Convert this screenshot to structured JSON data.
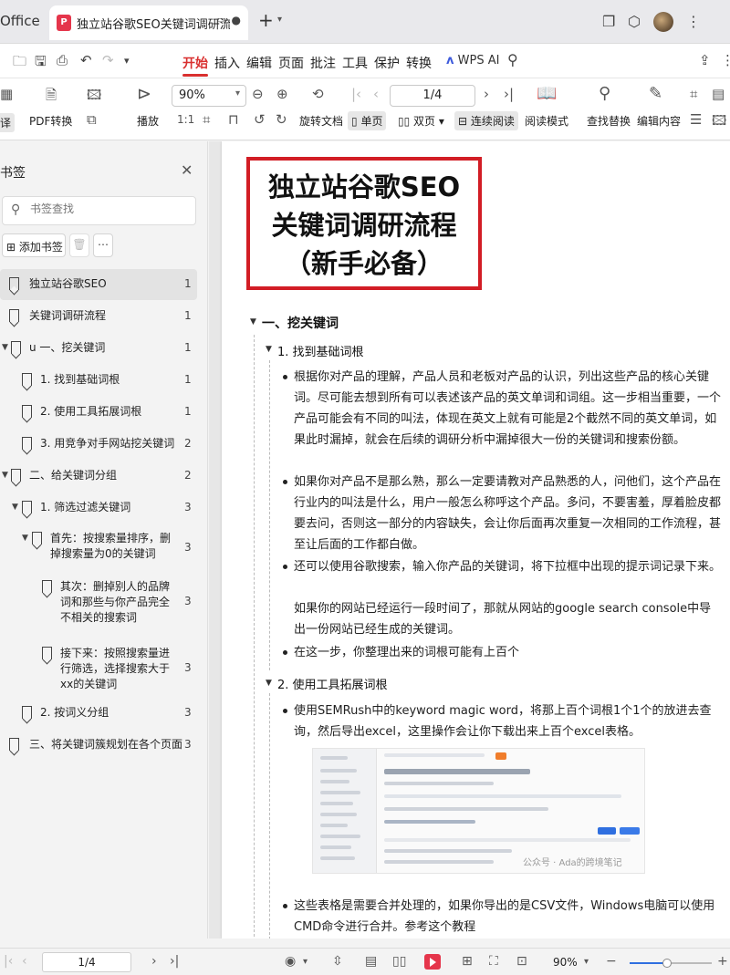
{
  "app": {
    "brand": "Office"
  },
  "tab": {
    "title": "独立站谷歌SEO关键词调研流程",
    "badge": "P"
  },
  "menu": {
    "items": [
      "开始",
      "插入",
      "编辑",
      "页面",
      "批注",
      "工具",
      "保护",
      "转换"
    ],
    "active_index": 0,
    "ai_label": "WPS AI"
  },
  "toolbar": {
    "pdf_convert": "PDF转换",
    "play": "播放",
    "zoom": "90%",
    "page": "1/4",
    "rotate": "旋转文档",
    "single": "单页",
    "double": "双页",
    "continuous": "连续阅读",
    "read_mode": "阅读模式",
    "find_replace": "查找替换",
    "edit_content": "编辑内容"
  },
  "sidebar": {
    "title": "书签",
    "search_placeholder": "书签查找",
    "add_button": "添加书签",
    "bookmarks": [
      {
        "label": "独立站谷歌SEO",
        "page": "1"
      },
      {
        "label": "关键词调研流程",
        "page": "1"
      },
      {
        "label": "u 一、挖关键词",
        "page": "1"
      },
      {
        "label": "1. 找到基础词根",
        "page": "1"
      },
      {
        "label": "2. 使用工具拓展词根",
        "page": "1"
      },
      {
        "label": "3. 用竞争对手网站挖关键词",
        "page": "2"
      },
      {
        "label": "二、给关键词分组",
        "page": "2"
      },
      {
        "label": "1. 筛选过滤关键词",
        "page": "3"
      },
      {
        "label": "首先：按搜索量排序，删掉搜索量为0的关键词",
        "page": "3"
      },
      {
        "label": "其次：删掉别人的品牌词和那些与你产品完全不相关的搜索词",
        "page": "3"
      },
      {
        "label": "接下来：按照搜索量进行筛选，选择搜索大于xx的关键词",
        "page": "3"
      },
      {
        "label": "2. 按词义分组",
        "page": "3"
      },
      {
        "label": "三、将关键词簇规划在各个页面",
        "page": "3"
      }
    ]
  },
  "document": {
    "title_lines": [
      "独立站谷歌SEO",
      "关键词调研流程",
      "（新手必备）"
    ],
    "h1": "一、挖关键词",
    "sec1": "1. 找到基础词根",
    "p1": "根据你对产品的理解，产品人员和老板对产品的认识，列出这些产品的核心关键词。尽可能去想到所有可以表述该产品的英文单词和词组。这一步相当重要，一个产品可能会有不同的叫法，体现在英文上就有可能是2个截然不同的英文单词，如果此时漏掉，就会在后续的调研分析中漏掉很大一份的关键词和搜索份额。",
    "p2": "如果你对产品不是那么熟，那么一定要请教对产品熟悉的人，问他们，这个产品在行业内的叫法是什么，用户一般怎么称呼这个产品。多问，不要害羞，厚着脸皮都要去问，否则这一部分的内容缺失，会让你后面再次重复一次相同的工作流程，甚至让后面的工作都白做。",
    "p3a": "还可以使用谷歌搜索，输入你产品的关键词，将下拉框中出现的提示词记录下来。",
    "p3b": "如果你的网站已经运行一段时间了，那就从网站的google search console中导出一份网站已经生成的关键词。",
    "p4": "在这一步，你整理出来的词根可能有上百个",
    "sec2": "2. 使用工具拓展词根",
    "p5": "使用SEMRush中的keyword magic word，将那上百个词根1个1个的放进去查询，然后导出excel，这里操作会让你下载出来上百个excel表格。",
    "shot_watermark": "公众号 · Ada的跨境笔记",
    "p6": "这些表格是需要合并处理的，如果你导出的是CSV文件，Windows电脑可以使用CMD命令进行合并。参考这个教程"
  },
  "status": {
    "page": "1/4",
    "zoom": "90%",
    "zoom_fraction": 0.45
  }
}
